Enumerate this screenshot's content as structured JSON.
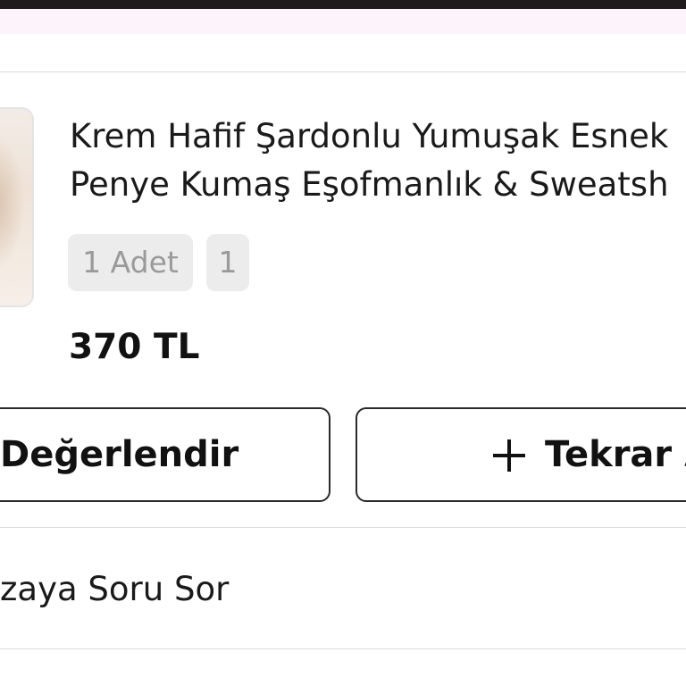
{
  "order_item": {
    "title_line1": "Krem Hafif Şardonlu Yumuşak Esnek",
    "title_line2": "Penye Kumaş Eşofmanlık & Sweatsh",
    "quantity_chip": "1 Adet",
    "size_chip": "1",
    "price": "370 TL"
  },
  "actions": {
    "review_label": "Değerlendir",
    "reorder_label": "Tekrar A"
  },
  "links": {
    "ask_seller_label": "zaya Soru Sor"
  },
  "colors": {
    "top_bar": "#1f1b1d",
    "top_band": "#fcf3fb",
    "chip_background": "#ececec",
    "chip_text": "#9a9a9a",
    "divider": "#dcdcdc"
  },
  "icons": {
    "reorder": "plus-icon"
  }
}
